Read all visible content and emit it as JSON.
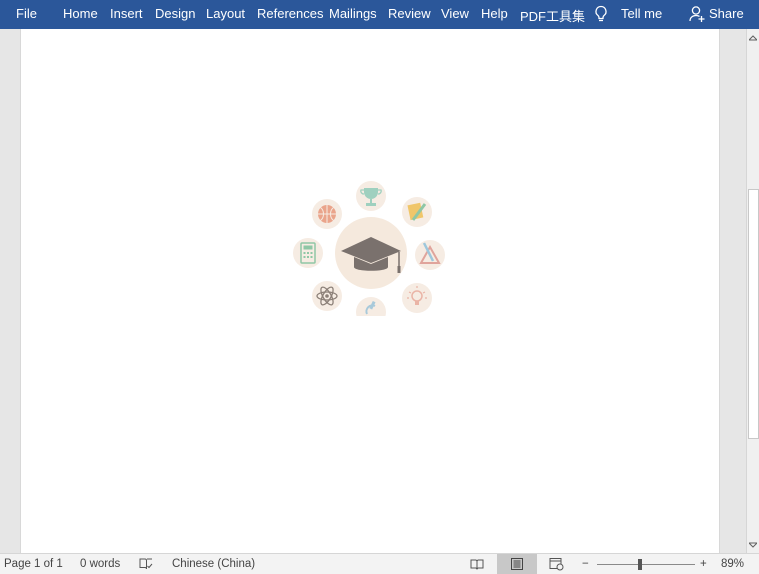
{
  "ribbon": {
    "tabs": [
      "File",
      "Home",
      "Insert",
      "Design",
      "Layout",
      "References",
      "Mailings",
      "Review",
      "View",
      "Help",
      "PDF工具集"
    ],
    "tell_me": "Tell me",
    "share": "Share",
    "bg_color": "#2b579a"
  },
  "document": {
    "image": {
      "center_icon": "graduation-cap-icon",
      "ring_icons": [
        "trophy-icon",
        "notebook-pencil-icon",
        "ruler-triangle-icon",
        "lightbulb-icon",
        "microscope-icon",
        "atom-icon",
        "calculator-icon",
        "basketball-icon"
      ]
    }
  },
  "statusbar": {
    "page": "Page 1 of 1",
    "words": "0 words",
    "language": "Chinese (China)",
    "zoom": "89%",
    "zoom_minus": "−",
    "zoom_plus": "+"
  }
}
